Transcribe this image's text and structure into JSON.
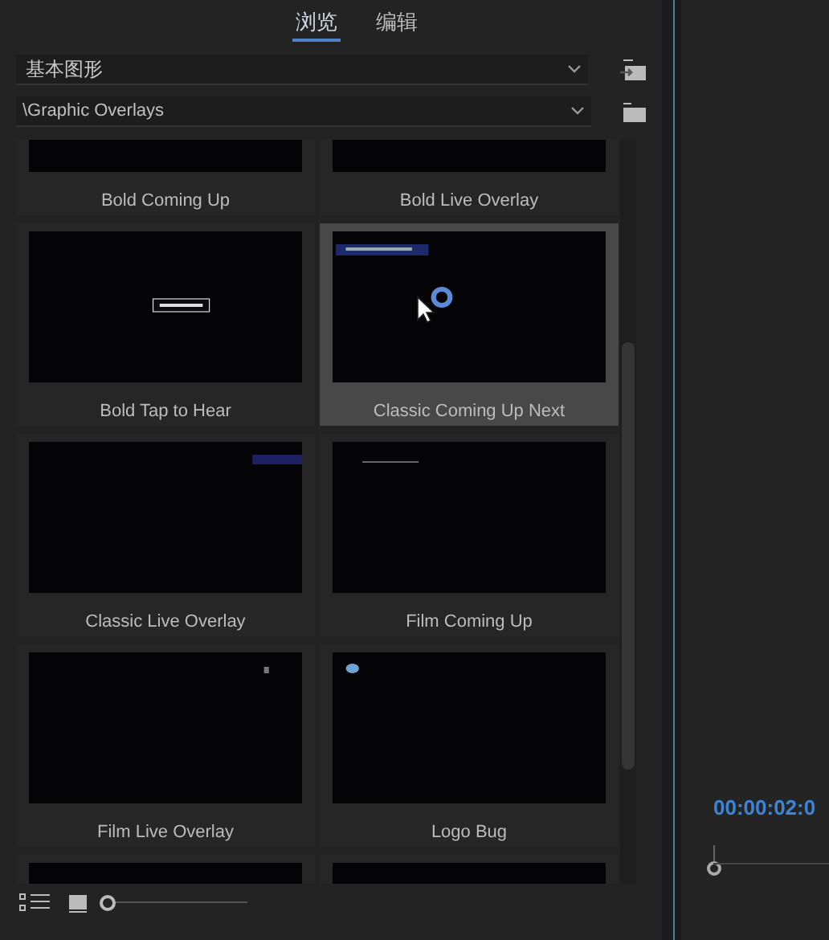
{
  "tabs": [
    {
      "label": "浏览",
      "selected": true
    },
    {
      "label": "编辑",
      "selected": false
    }
  ],
  "library_dropdown": {
    "value": "基本图形"
  },
  "folder_dropdown": {
    "value": "\\Graphic Overlays"
  },
  "presets": [
    {
      "label": "Bold Coming Up",
      "selected": false,
      "kind": "plain"
    },
    {
      "label": "Bold Live Overlay",
      "selected": false,
      "kind": "plain"
    },
    {
      "label": "Bold Tap to Hear",
      "selected": false,
      "kind": "center-title"
    },
    {
      "label": "Classic Coming Up Next",
      "selected": true,
      "kind": "top-banner"
    },
    {
      "label": "Classic Live Overlay",
      "selected": false,
      "kind": "corner-tag"
    },
    {
      "label": "Film Coming Up",
      "selected": false,
      "kind": "top-line"
    },
    {
      "label": "Film Live Overlay",
      "selected": false,
      "kind": "corner-dot"
    },
    {
      "label": "Logo Bug",
      "selected": false,
      "kind": "logo"
    },
    {
      "selected": false,
      "kind": "plain"
    },
    {
      "selected": false,
      "kind": "plain"
    }
  ],
  "zoom_slider": {
    "level": 0
  },
  "timecode": "00:00:02:0"
}
